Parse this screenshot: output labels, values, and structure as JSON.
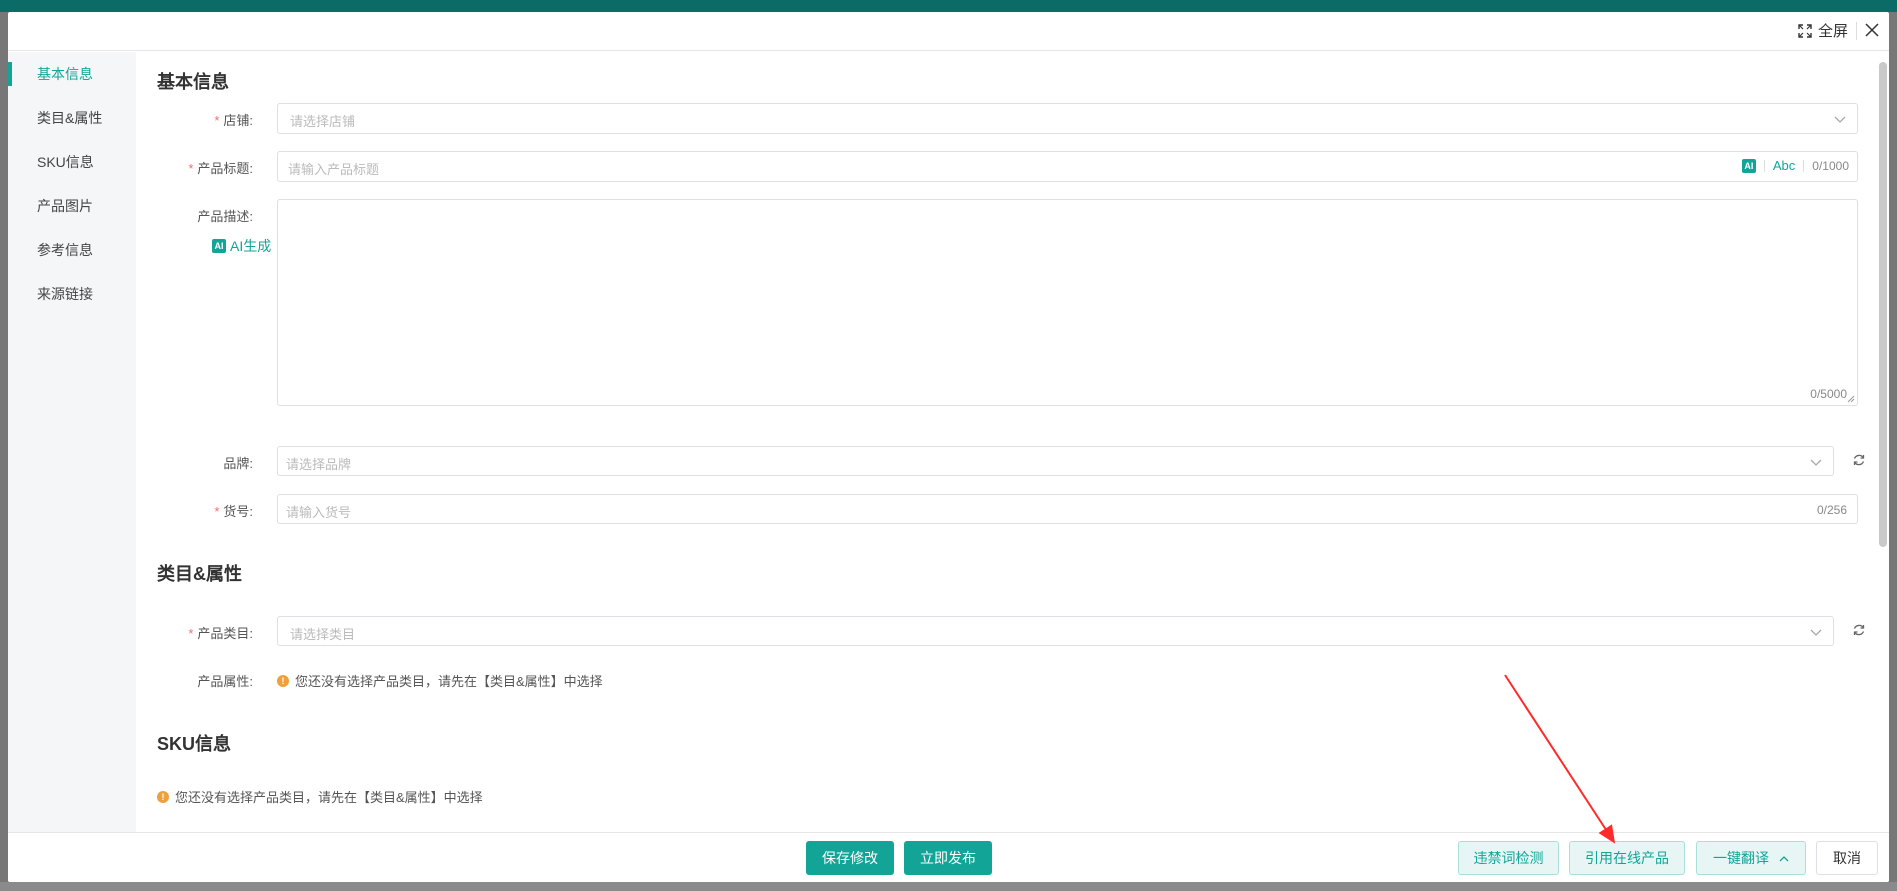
{
  "header": {
    "fullscreen_label": "全屏"
  },
  "sidebar": {
    "items": [
      {
        "label": "基本信息"
      },
      {
        "label": "类目&属性"
      },
      {
        "label": "SKU信息"
      },
      {
        "label": "产品图片"
      },
      {
        "label": "参考信息"
      },
      {
        "label": "来源链接"
      }
    ]
  },
  "basic": {
    "title": "基本信息",
    "store_label": "店铺:",
    "store_placeholder": "请选择店铺",
    "product_title_label": "产品标题:",
    "product_title_placeholder": "请输入产品标题",
    "ai_badge": "AI",
    "abc_label": "Abc",
    "product_title_counter": "0/1000",
    "desc_label": "产品描述:",
    "ai_generate_label": "AI生成",
    "desc_counter": "0/5000",
    "brand_label": "品牌:",
    "brand_placeholder": "请选择品牌",
    "sku_no_label": "货号:",
    "sku_no_placeholder": "请输入货号",
    "sku_no_counter": "0/256"
  },
  "category": {
    "title": "类目&属性",
    "category_label": "产品类目:",
    "category_placeholder": "请选择类目",
    "attr_label": "产品属性:",
    "attr_notice": "您还没有选择产品类目，请先在【类目&属性】中选择"
  },
  "sku": {
    "title": "SKU信息",
    "notice": "您还没有选择产品类目，请先在【类目&属性】中选择"
  },
  "footer": {
    "save_label": "保存修改",
    "publish_label": "立即发布",
    "forbidden_check_label": "违禁词检测",
    "quote_online_label": "引用在线产品",
    "translate_label": "一键翻译",
    "cancel_label": "取消"
  },
  "colors": {
    "accent": "#12a597",
    "required": "#f56c6c",
    "warning": "#f0a03a",
    "annotation": "#ff2a2a"
  }
}
